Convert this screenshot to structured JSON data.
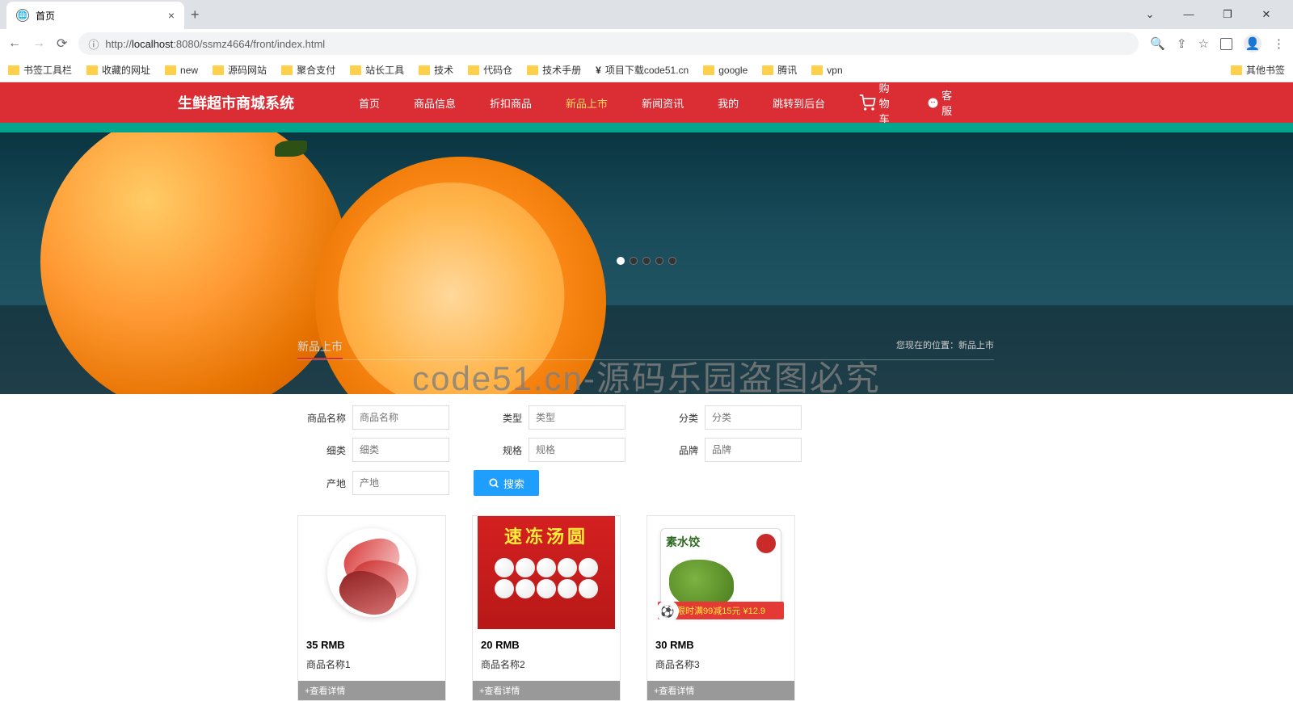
{
  "browser": {
    "tab_title": "首页",
    "url_prefix": "http://",
    "url_host": "localhost",
    "url_port": ":8080",
    "url_path": "/ssmz4664/front/index.html",
    "window": {
      "min": "—",
      "max": "❐",
      "close": "✕",
      "down": "⌄"
    }
  },
  "bookmarks": [
    "书签工具栏",
    "收藏的网址",
    "new",
    "源码网站",
    "聚合支付",
    "站长工具",
    "技术",
    "代码仓",
    "技术手册",
    "项目下载code51.cn",
    "google",
    "腾讯",
    "vpn"
  ],
  "bookmarks_right": "其他书签",
  "site": {
    "logo": "生鲜超市商城系统",
    "nav": [
      "首页",
      "商品信息",
      "折扣商品",
      "新品上市",
      "新闻资讯",
      "我的",
      "跳转到后台"
    ],
    "nav_active_index": 3,
    "cart": "购物车",
    "service": "客服"
  },
  "banner": {
    "section_title": "新品上市",
    "breadcrumb": "您现在的位置：新品上市",
    "watermark": "code51.cn-源码乐园盗图必究"
  },
  "filters": {
    "row1": [
      {
        "label": "商品名称",
        "placeholder": "商品名称"
      },
      {
        "label": "类型",
        "placeholder": "类型"
      },
      {
        "label": "分类",
        "placeholder": "分类"
      }
    ],
    "row2": [
      {
        "label": "细类",
        "placeholder": "细类"
      },
      {
        "label": "规格",
        "placeholder": "规格"
      },
      {
        "label": "品牌",
        "placeholder": "品牌"
      }
    ],
    "row3": [
      {
        "label": "产地",
        "placeholder": "产地"
      }
    ],
    "search": "搜索"
  },
  "products": [
    {
      "price": "35 RMB",
      "name": "商品名称1",
      "btn": "+查看详情"
    },
    {
      "price": "20 RMB",
      "name": "商品名称2",
      "btn": "+查看详情",
      "frozen_label": "速冻汤圆"
    },
    {
      "price": "30 RMB",
      "name": "商品名称3",
      "btn": "+查看详情",
      "dumpling_text": "素水饺",
      "promo": "限时满99减15元 ¥12.9",
      "promo_icon": "⚽"
    }
  ]
}
